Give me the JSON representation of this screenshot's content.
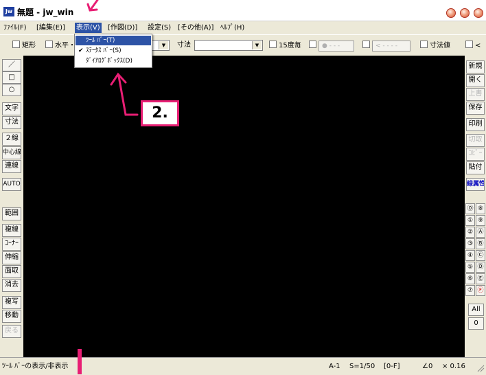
{
  "window": {
    "icon": "Jw",
    "title": "無題 - jw_win",
    "buttons": [
      "minimize-button",
      "maximize-button",
      "close-button"
    ]
  },
  "menu": [
    "ﾌｧｲﾙ(F)",
    "[編集(E)]",
    "表示(V)",
    "[作図(D)]",
    "設定(S)",
    "[その他(A)]",
    "ﾍﾙﾌﾟ(H)"
  ],
  "dropdown": {
    "items": [
      {
        "label": "ﾂｰﾙ ﾊﾞｰ(T)",
        "checked": false,
        "highlighted": true
      },
      {
        "label": "ｽﾃｰﾀｽ ﾊﾞｰ(S)",
        "checked": true,
        "highlighted": false
      },
      {
        "label": "ﾀﾞｲｱﾛｸﾞﾎﾞｯｸｽ(D)",
        "checked": false,
        "highlighted": false
      }
    ],
    "checkmark": "✔"
  },
  "toolbar": {
    "rect_label": "矩形",
    "horizontal_label": "水平・",
    "dimension_label": "寸法",
    "angle_label": "15度毎",
    "dim_value_label": "寸法値",
    "last_label": "<",
    "spin1_text": "● - - -",
    "spin2_text": "< - - - -"
  },
  "left_tools": [
    "／",
    "□",
    "○",
    "文字",
    "寸法",
    "２線",
    "中心線",
    "連線",
    "AUTO",
    "範囲",
    "複線",
    "ｺｰﾅｰ",
    "伸縮",
    "面取",
    "消去",
    "複写",
    "移動",
    "戻る"
  ],
  "right_tools": [
    "新規",
    "開く",
    "上書",
    "保存",
    "印刷",
    "切取",
    "ｺﾋﾟｰ",
    "貼付",
    "線属性"
  ],
  "layer_numbers": [
    "⓪",
    "①",
    "②",
    "③",
    "④",
    "⑤",
    "⑥",
    "⑦"
  ],
  "layer_letters": [
    "⑧",
    "⑨",
    "Ⓐ",
    "Ⓑ",
    "Ⓒ",
    "Ⓓ",
    "Ⓔ",
    "Ⓕ"
  ],
  "layer_all": "All",
  "layer_zero": "0",
  "status": {
    "message": "ﾂｰﾙ ﾊﾞｰの表示/非表示",
    "paper": "A-1",
    "scale": "S=1/50",
    "layer": "[0-F]",
    "angle": "∠0",
    "zoom": "× 0.16"
  },
  "annotation": {
    "step": "2."
  },
  "colors": {
    "accent": "#e81e74",
    "canvas": "#000000",
    "menu_highlight": "#2d53a6"
  }
}
